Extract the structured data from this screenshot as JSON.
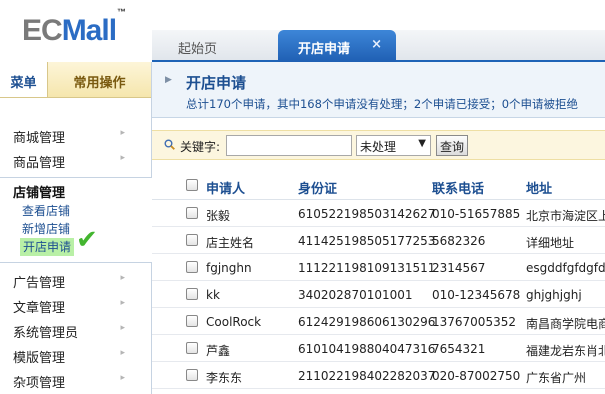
{
  "logo": {
    "ec": "EC",
    "mall": "Mall",
    "tm": "™"
  },
  "tabs": {
    "home": "起始页",
    "active": "开店申请",
    "close_glyph": "×"
  },
  "sidebar": {
    "tab_menu": "菜单",
    "tab_common": "常用操作",
    "items_top": [
      {
        "label": "商城管理"
      },
      {
        "label": "商品管理"
      }
    ],
    "open_group": {
      "title": "店铺管理",
      "subs": [
        "查看店铺",
        "新增店铺",
        "开店申请"
      ]
    },
    "items_bottom": [
      {
        "label": "广告管理"
      },
      {
        "label": "文章管理"
      },
      {
        "label": "系统管理员"
      },
      {
        "label": "模版管理"
      },
      {
        "label": "杂项管理"
      }
    ],
    "arrow_glyph": "▸",
    "check_glyph": "✔"
  },
  "main": {
    "title": "开店申请",
    "summary": "总计170个申请，其中168个申请没有处理；2个申请已接受；0个申请被拒绝",
    "search": {
      "label": "关键字:",
      "keyword_value": "",
      "status_selected": "未处理",
      "button": "查询"
    },
    "table": {
      "headers": [
        "申请人",
        "身份证",
        "联系电话",
        "地址"
      ],
      "rows": [
        {
          "name": "张毅",
          "id": "610522198503142627",
          "phone": "010-51657885",
          "addr": "北京市海淀区上"
        },
        {
          "name": "店主姓名",
          "id": "411425198505177253",
          "phone": "5682326",
          "addr": "详细地址"
        },
        {
          "name": "fgjnghn",
          "id": "111221198109131511",
          "phone": "2314567",
          "addr": "esgddfgfdgfd"
        },
        {
          "name": "kk",
          "id": "340202870101001",
          "phone": "010-12345678",
          "addr": "ghjghjghj"
        },
        {
          "name": "CoolRock",
          "id": "612429198606130296",
          "phone": "13767005352",
          "addr": "南昌商学院电商"
        },
        {
          "name": "芦鑫",
          "id": "610104198804047316",
          "phone": "7654321",
          "addr": "福建龙岩东肖北"
        },
        {
          "name": "李东东",
          "id": "211022198402282037",
          "phone": "020-87002750",
          "addr": "广东省广州"
        }
      ]
    }
  },
  "colors": {
    "brand_blue": "#1d4f91",
    "tab_blue": "#2b6fc6",
    "active_highlight": "#b9f0a6",
    "search_bg": "#fcf6df"
  }
}
